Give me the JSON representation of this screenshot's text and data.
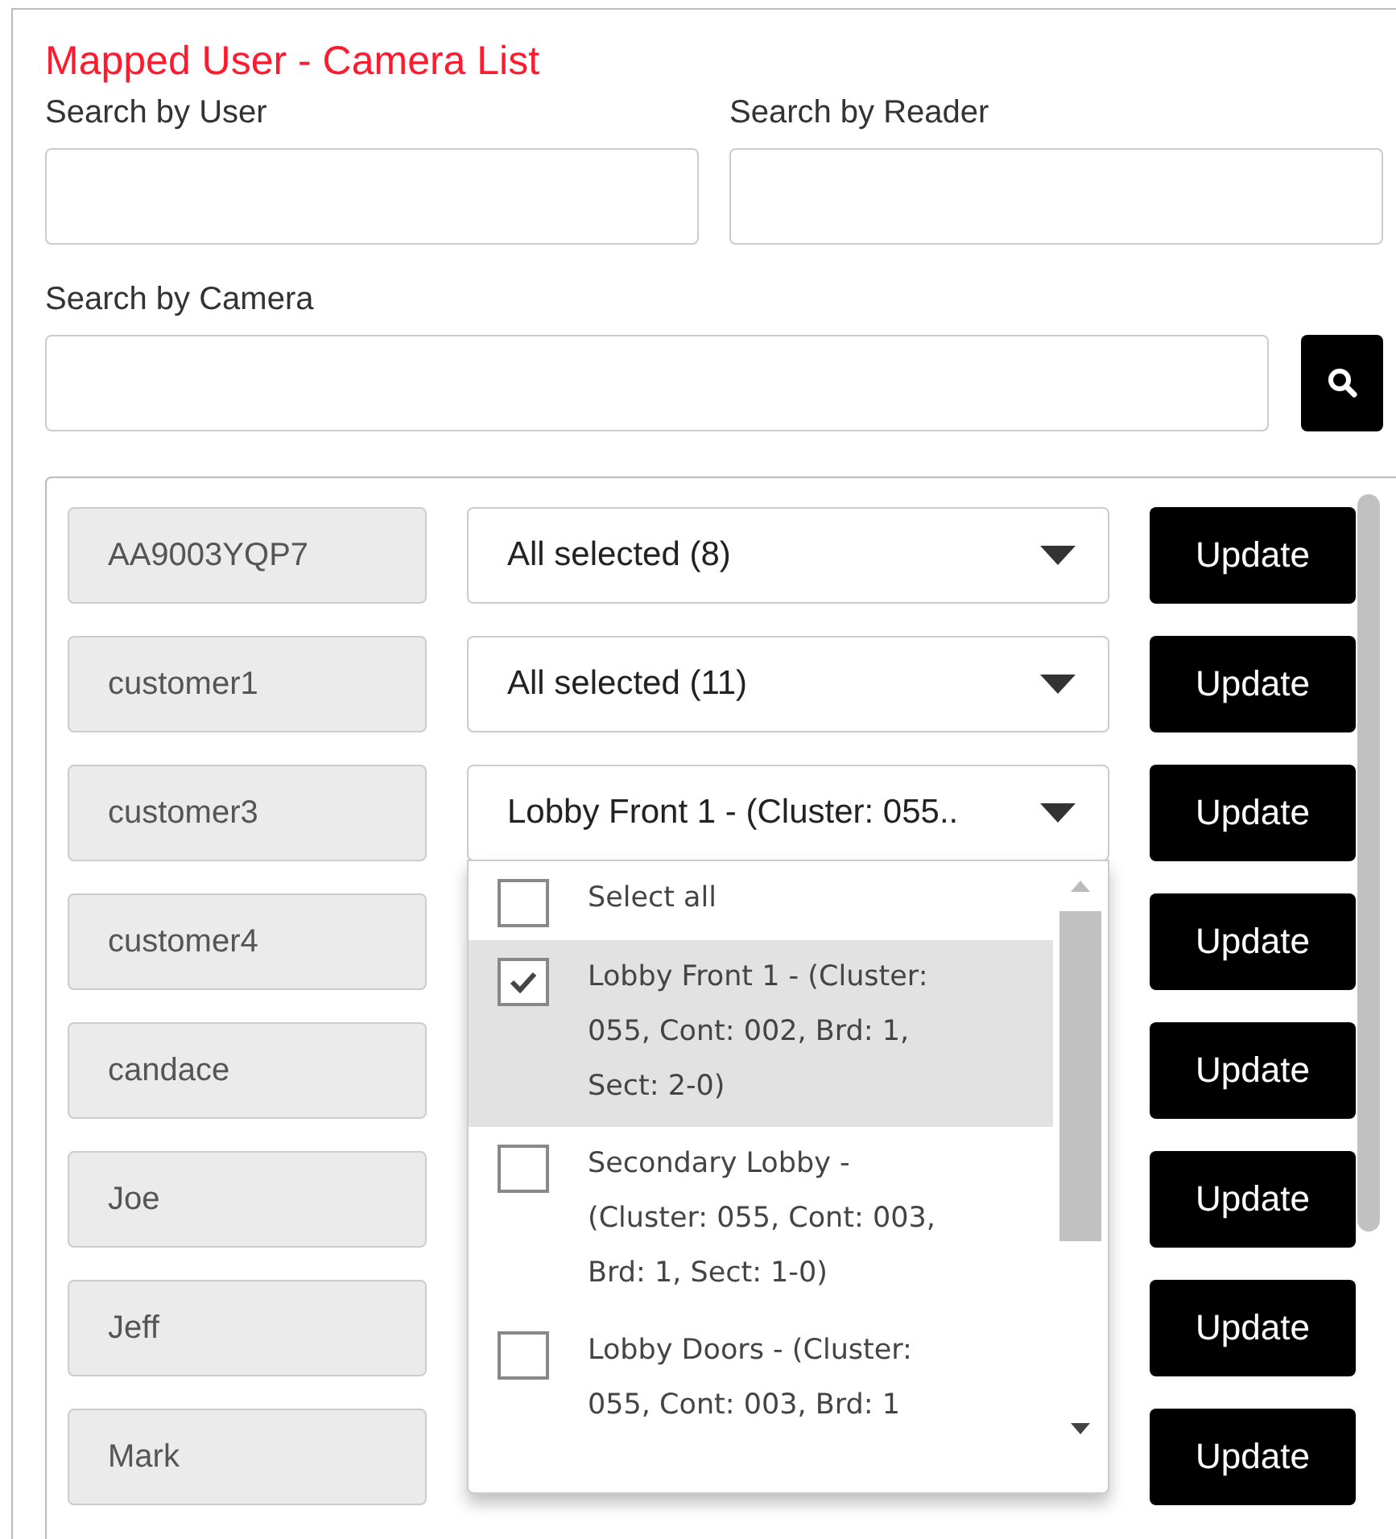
{
  "title": "Mapped User - Camera List",
  "filters": [
    {
      "label": "Search by User"
    },
    {
      "label": "Search by Reader"
    },
    {
      "label": "Search by Camera"
    }
  ],
  "rows": [
    {
      "user": "AA9003YQP7",
      "selection": "All selected (8)",
      "action": "Update"
    },
    {
      "user": "customer1",
      "selection": "All selected (11)",
      "action": "Update"
    },
    {
      "user": "customer3",
      "selection": "Lobby Front 1 - (Cluster: 055..",
      "action": "Update",
      "dropdown": {
        "options": [
          {
            "label": "Select all",
            "checked": false,
            "selected": false
          },
          {
            "label": "Lobby Front 1 - (Cluster: 055, Cont: 002, Brd: 1, Sect: 2-0)",
            "checked": true,
            "selected": true
          },
          {
            "label": "Secondary Lobby - (Cluster: 055, Cont: 003, Brd: 1, Sect: 1-0)",
            "checked": false,
            "selected": false
          },
          {
            "label": "Lobby Doors - (Cluster: 055, Cont: 003, Brd: 1",
            "checked": false,
            "selected": false
          }
        ]
      }
    },
    {
      "user": "customer4",
      "action": "Update"
    },
    {
      "user": "candace",
      "action": "Update"
    },
    {
      "user": "Joe",
      "action": "Update"
    },
    {
      "user": "Jeff",
      "action": "Update"
    },
    {
      "user": "Mark",
      "action": "Update"
    }
  ]
}
